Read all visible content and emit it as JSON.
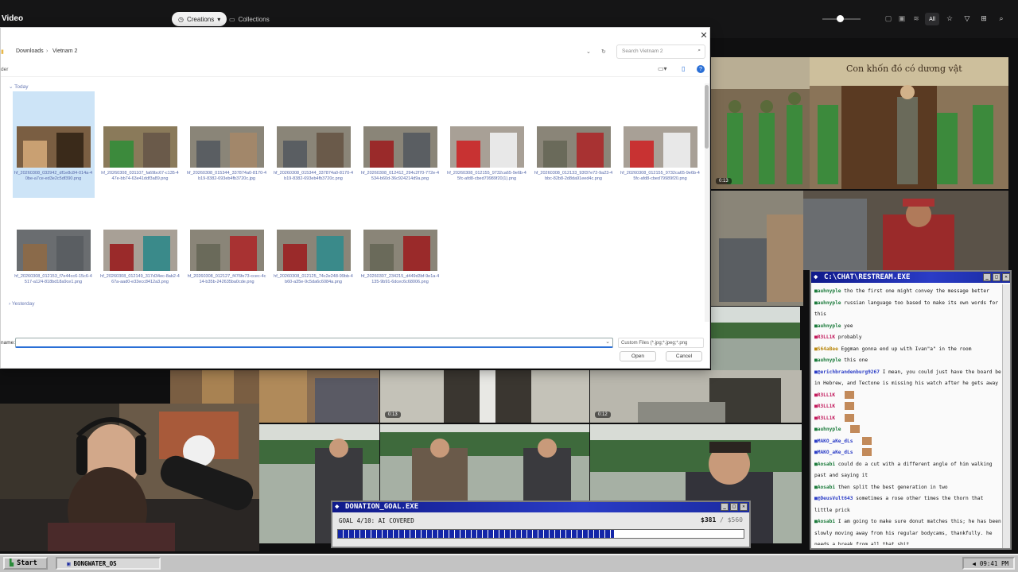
{
  "app": {
    "title": "Video"
  },
  "topbar": {
    "creations": "Creations",
    "collections": "Collections",
    "all": "All"
  },
  "gallery": {
    "durations": [
      "0:13",
      "0:13",
      "0:12"
    ],
    "street_sign": "Con khốn đó có dương vật"
  },
  "dialog": {
    "breadcrumb": [
      "Downloads",
      "Vietnam 2"
    ],
    "search_placeholder": "Search Vietnam 2",
    "side_label": "der",
    "group_today": "Today",
    "group_yesterday": "Yesterday",
    "files": [
      {
        "name": "hf_20260308_032942_df1e8c84-014a-40be-a7ce-ed3e2c5df390.png",
        "selected": true
      },
      {
        "name": "hf_20260308_031107_fa69bc67-c135-447e-bb74-63e41ddf3a89.png"
      },
      {
        "name": "hf_20260308_015344_337874a0-8170-4b19-8382-693eb4fb3720c.jpg"
      },
      {
        "name": "hf_20260308_015344_337874a0-8170-4b19-8382-693eb4fb3720c.png"
      },
      {
        "name": "hf_20260308_012412_294c2f70-772e-4534-b60d-36c924214d9a.png"
      },
      {
        "name": "hf_20260308_012155_9732ca65-9e6b-45fc-afd8-cbed79989f20(1).png"
      },
      {
        "name": "hf_20260308_012133_93f37e72-9a23-4bbc-82b8-2d8da91eed4c.png"
      },
      {
        "name": "hf_20260308_012155_9732ca65-9e6b-45fc-afd8-cbed79989f20.png"
      },
      {
        "name": "hf_20260308_012153_f7e44cc6-15c6-4517-a124-818bd18a9ce1.png"
      },
      {
        "name": "hf_20260308_012149_317d34ec-8ab2-467a-aad0-e33ecc8412a3.png"
      },
      {
        "name": "hf_20260308_012127_f476fe73-ccec-4c14-b35b-242635ba0cde.png"
      },
      {
        "name": "hf_20260308_012125_74c2e248-99bb-4b60-a35e-9c5da6c6084a.png"
      },
      {
        "name": "hf_20260307_234215_d449d3bf-9e1a-4135-9b91-6dcec6c68006.png"
      }
    ],
    "filename_label": "name:",
    "filetype": "Custom Files (*.jpg;*.jpeg;*.png",
    "open": "Open",
    "cancel": "Cancel"
  },
  "chat": {
    "title": "C:\\CHAT\\RESTREAM.EXE",
    "messages": [
      {
        "user": "auhnyple",
        "text": "tho the first one might convey the message better",
        "color": "#1a7a3a"
      },
      {
        "user": "auhnyple",
        "text": "russian language too based to make its own words for this",
        "color": "#1a7a3a"
      },
      {
        "user": "auhnyple",
        "text": "yee",
        "color": "#1a7a3a"
      },
      {
        "user": "R3LL1K",
        "text": "probably",
        "color": "#c2185b"
      },
      {
        "user": "S64aBee",
        "text": "Eggman gonna end up with Ivan\"a\" in the room",
        "color": "#b8860b"
      },
      {
        "user": "auhnyple",
        "text": "this one",
        "color": "#1a7a3a"
      },
      {
        "user": "@erichbrandenburg9267",
        "text": "I mean, you could just have the board be in Hebrew, and Tectone is missing his watch after he gets away",
        "color": "#2a3cc6"
      },
      {
        "user": "R3LL1K",
        "text": "",
        "color": "#c2185b"
      },
      {
        "user": "R3LL1K",
        "text": "",
        "color": "#c2185b"
      },
      {
        "user": "R3LL1K",
        "text": "",
        "color": "#c2185b"
      },
      {
        "user": "auhnyple",
        "text": "",
        "color": "#1a7a3a"
      },
      {
        "user": "MAKO_aKe_dLs",
        "text": "",
        "color": "#2a3cc6"
      },
      {
        "user": "MAKO_aKe_dLs",
        "text": "",
        "color": "#2a3cc6"
      },
      {
        "user": "Aosabi",
        "text": "could do a cut with a different angle of him walking past and saying it",
        "color": "#1a7a3a"
      },
      {
        "user": "Aosabi",
        "text": "then split the best generation in two",
        "color": "#1a7a3a"
      },
      {
        "user": "@DeusVult643",
        "text": "sometimes a rose other times the thorn that little prick",
        "color": "#2a3cc6"
      },
      {
        "user": "Aosabi",
        "text": "I am going to make sure donut matches this; he has been slowly moving away from his regular bodycams, thankfully. he needs a break from all that shit",
        "color": "#1a7a3a"
      }
    ]
  },
  "donation": {
    "title": "DONATION_GOAL.EXE",
    "goal_text": "GOAL 4/10: AI COVERED",
    "current": "$381",
    "target": "$560",
    "progress": 0.68
  },
  "taskbar": {
    "start": "Start",
    "item": "BONGWATER_OS",
    "time": "09:41 PM"
  },
  "colors": {
    "titlebar": "#1a2aa0",
    "accent": "#2a6fd6"
  }
}
